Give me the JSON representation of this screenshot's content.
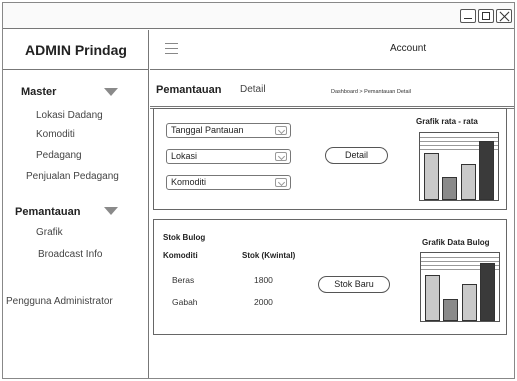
{
  "sidebar": {
    "brand": "ADMIN Prindag",
    "sections": [
      {
        "label": "Master",
        "items": [
          "Lokasi Dadang",
          "Komoditi",
          "Pedagang",
          "Penjualan Pedagang"
        ]
      },
      {
        "label": "Pemantauan",
        "items": [
          "Grafik",
          "Broadcast Info"
        ]
      }
    ],
    "footer_item": "Pengguna Administrator"
  },
  "header": {
    "menu_icon": "hamburger-icon",
    "account_label": "Account"
  },
  "page": {
    "title": "Pemantauan",
    "tab": "Detail",
    "breadcrumb": "Dashboard > Pemantauan Detail"
  },
  "filters": {
    "selects": [
      "Tanggal Pantauan",
      "Lokasi",
      "Komoditi"
    ],
    "detail_button": "Detail"
  },
  "stok": {
    "title": "Stok Bulog",
    "columns": [
      "Komoditi",
      "Stok (Kwintal)"
    ],
    "rows": [
      [
        "Beras",
        "1800"
      ],
      [
        "Gabah",
        "2000"
      ]
    ],
    "new_button": "Stok Baru"
  },
  "colors": {
    "bar_fill": "#c9c9c9",
    "bar_dark": "#3a3a3a",
    "bar_mid": "#8a8a8a",
    "border": "#777777"
  },
  "chart_data": [
    {
      "type": "bar",
      "title": "Grafik rata - rata",
      "values": [
        0.7,
        0.35,
        0.53,
        0.88
      ],
      "note": "placeholder wireframe chart, no axes printed"
    },
    {
      "type": "bar",
      "title": "Grafik Data Bulog",
      "values": [
        0.68,
        0.32,
        0.55,
        0.85
      ],
      "note": "placeholder wireframe chart, no axes printed"
    }
  ]
}
